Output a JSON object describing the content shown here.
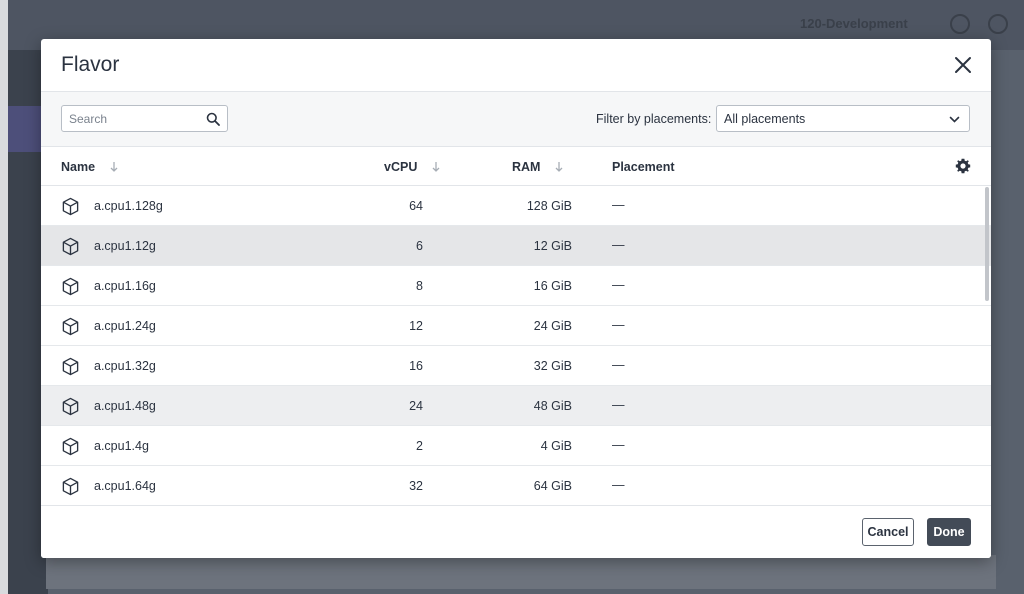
{
  "background": {
    "project_label": "120-Development"
  },
  "modal": {
    "title": "Flavor",
    "search": {
      "placeholder": "Search",
      "value": ""
    },
    "filter": {
      "label": "Filter by placements:",
      "selected": "All placements"
    },
    "columns": {
      "name": "Name",
      "vcpu": "vCPU",
      "ram": "RAM",
      "placement": "Placement"
    },
    "rows": [
      {
        "name": "a.cpu1.128g",
        "vcpu": "64",
        "ram": "128 GiB",
        "placement": "—"
      },
      {
        "name": "a.cpu1.12g",
        "vcpu": "6",
        "ram": "12 GiB",
        "placement": "—"
      },
      {
        "name": "a.cpu1.16g",
        "vcpu": "8",
        "ram": "16 GiB",
        "placement": "—"
      },
      {
        "name": "a.cpu1.24g",
        "vcpu": "12",
        "ram": "24 GiB",
        "placement": "—"
      },
      {
        "name": "a.cpu1.32g",
        "vcpu": "16",
        "ram": "32 GiB",
        "placement": "—"
      },
      {
        "name": "a.cpu1.48g",
        "vcpu": "24",
        "ram": "48 GiB",
        "placement": "—"
      },
      {
        "name": "a.cpu1.4g",
        "vcpu": "2",
        "ram": "4 GiB",
        "placement": "—"
      },
      {
        "name": "a.cpu1.64g",
        "vcpu": "32",
        "ram": "64 GiB",
        "placement": "—"
      }
    ],
    "selected_row": 1,
    "hovered_row": 5,
    "footer": {
      "cancel_label": "Cancel",
      "done_label": "Done"
    }
  },
  "icons": {
    "row_icon": "cube-icon",
    "search": "search-icon",
    "close": "close-icon",
    "settings": "gear-icon",
    "sort": "sort-arrow-down-icon",
    "dropdown": "chevron-down-icon"
  },
  "colors": {
    "primary_button": "#434b57",
    "selected_row": "#e5e6e8",
    "overlay": "#59616d"
  }
}
